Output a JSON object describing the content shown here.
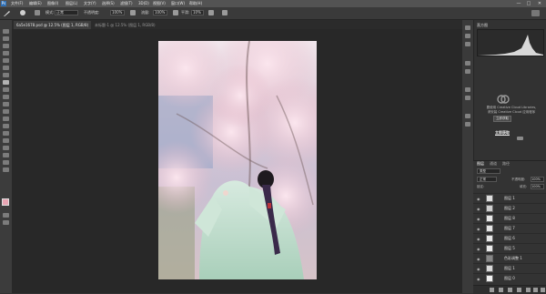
{
  "menu": {
    "app_icon": "Ps",
    "items": [
      "文件(F)",
      "编辑(E)",
      "图像(I)",
      "图层(L)",
      "文字(Y)",
      "选择(S)",
      "滤镜(T)",
      "3D(D)",
      "视图(V)",
      "窗口(W)",
      "帮助(H)"
    ],
    "window_controls": [
      "—",
      "□",
      "✕"
    ]
  },
  "options": {
    "mode_label": "模式:",
    "mode_value": "正常",
    "opacity_label": "不透明度:",
    "opacity_value": "100%",
    "flow_label": "流量:",
    "flow_value": "100%",
    "smooth_label": "平滑:",
    "smooth_value": "10%"
  },
  "tabs": [
    {
      "label": "6a5e1678.psd @ 12.5% (图层 1, RGB/8)",
      "active": true
    },
    {
      "label": "未标题-1 @ 12.5% (图层 1, RGB/8)",
      "active": false
    }
  ],
  "panels": {
    "histogram_tab": "直方图",
    "library_text_1": "要使用 Creative Cloud Libraries,",
    "library_text_2": "请安装 Creative Cloud 应用程序",
    "library_button": "立即获取",
    "library_link": "立即获取",
    "layer_tabs": [
      "图层",
      "通道",
      "路径"
    ],
    "kind_label": "类型",
    "blend_mode": "正常",
    "opacity_label": "不透明度:",
    "opacity_value": "100%",
    "lock_label": "锁定:",
    "fill_label": "填充:",
    "fill_value": "100%"
  },
  "layers": [
    {
      "name": "图层 1",
      "thumb": "#dedede",
      "selected": false
    },
    {
      "name": "图层 2",
      "thumb": "#cfcfcf",
      "selected": false
    },
    {
      "name": "图层 8",
      "thumb": "#e8e8e8",
      "selected": false
    },
    {
      "name": "图层 7",
      "thumb": "#e4e4e4",
      "selected": false
    },
    {
      "name": "图层 6",
      "thumb": "#e8e8e8",
      "selected": false
    },
    {
      "name": "图层 5",
      "thumb": "#eaeaea",
      "selected": false
    },
    {
      "name": "色彩调整 1",
      "thumb": "#888888",
      "selected": false
    },
    {
      "name": "图层 1",
      "thumb": "#d9d9d9",
      "selected": false
    },
    {
      "name": "图层 0",
      "thumb": "#f0f0f0",
      "selected": false
    }
  ],
  "colors": {
    "accent": "#2f6fb5",
    "ui_dark": "#323232",
    "canvas_bg": "#282828"
  }
}
